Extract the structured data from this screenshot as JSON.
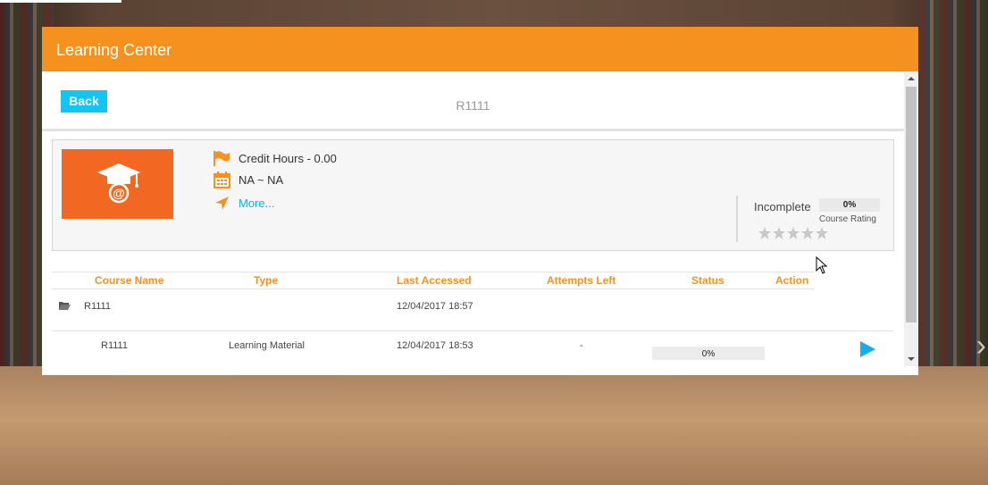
{
  "header": {
    "title": "Learning Center"
  },
  "toolbar": {
    "back_label": "Back",
    "course_code": "R1111"
  },
  "course": {
    "credit_hours": "Credit Hours - 0.00",
    "date_range": "NA ~ NA",
    "more_label": "More...",
    "status": "Incomplete",
    "rating_percent": "0%",
    "rating_label": "Course Rating",
    "stars": 0,
    "stars_total": 5
  },
  "table": {
    "columns": [
      "Course Name",
      "Type",
      "Last Accessed",
      "Attempts Left",
      "Status",
      "Action"
    ],
    "folder_row": {
      "name": "R1111",
      "last_accessed": "12/04/2017 18:57"
    },
    "item_row": {
      "name": "R1111",
      "type": "Learning Material",
      "last_accessed": "12/04/2017 18:53",
      "attempts_left": "-",
      "progress": "0%"
    }
  },
  "colors": {
    "accent": "#f5921f",
    "button": "#13c5f4",
    "thumbnail": "#f26722",
    "link": "#13aef0"
  },
  "icons": {
    "thumbnail": "graduation-cap-icon",
    "credit": "flag-icon",
    "date": "calendar-icon",
    "more": "location-arrow-icon",
    "folder": "folder-open-icon",
    "action": "play-icon"
  }
}
